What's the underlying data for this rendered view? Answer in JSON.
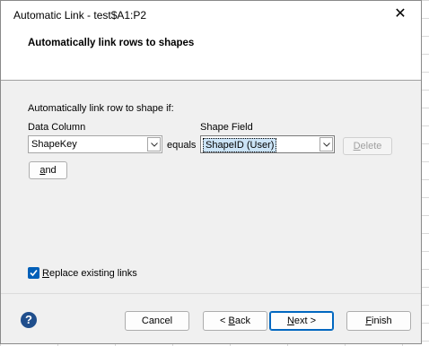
{
  "window": {
    "title": "Automatic Link - test$A1:P2",
    "close_glyph": "✕"
  },
  "header": {
    "title": "Automatically link rows to shapes"
  },
  "form": {
    "intro": "Automatically link row to shape if:",
    "data_column_label": "Data Column",
    "data_column_value": "ShapeKey",
    "equals_label": "equals",
    "shape_field_label": "Shape Field",
    "shape_field_value": "ShapeID (User)",
    "delete_prefix": "",
    "delete_accel": "D",
    "delete_rest": "elete",
    "and_accel": "a",
    "and_rest": "nd",
    "replace_accel": "R",
    "replace_rest": "eplace existing links",
    "replace_checked": true
  },
  "footer": {
    "help_glyph": "?",
    "cancel": "Cancel",
    "back_prefix": "< ",
    "back_accel": "B",
    "back_rest": "ack",
    "next_accel": "N",
    "next_rest": "ext >",
    "finish_accel": "F",
    "finish_rest": "inish"
  },
  "colors": {
    "accent": "#005fb8",
    "default_border": "#0067c0",
    "selection": "#cce4f7"
  }
}
